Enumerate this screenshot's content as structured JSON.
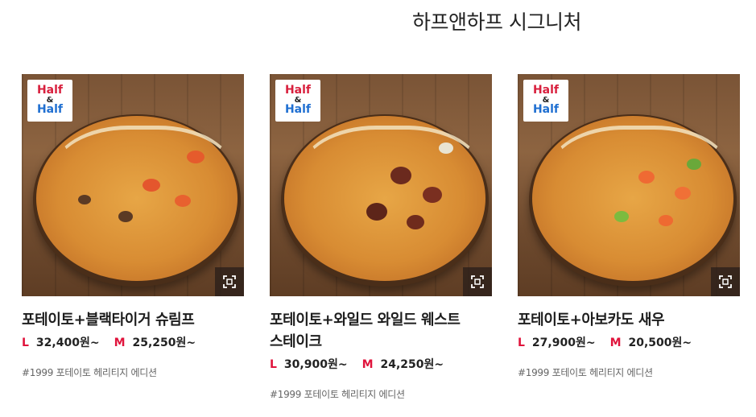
{
  "page": {
    "title": "하프앤하프 시그니처"
  },
  "badge": {
    "line1": "Half",
    "amp": "&",
    "line2": "Half"
  },
  "products": [
    {
      "name": "포테이토+블랙타이거 슈림프",
      "price_l_label": "L",
      "price_l": "32,400원~",
      "price_m_label": "M",
      "price_m": "25,250원~",
      "note": "#1999 포테이토 헤리티지 에디션",
      "image_icon": "pizza-image"
    },
    {
      "name": "포테이토+와일드 와일드 웨스트 스테이크",
      "price_l_label": "L",
      "price_l": "30,900원~",
      "price_m_label": "M",
      "price_m": "24,250원~",
      "note": "#1999 포테이토 헤리티지 에디션",
      "image_icon": "pizza-image"
    },
    {
      "name": "포테이토+아보카도 새우",
      "price_l_label": "L",
      "price_l": "27,900원~",
      "price_m_label": "M",
      "price_m": "20,500원~",
      "note": "#1999 포테이토 헤리티지 에디션",
      "image_icon": "pizza-image"
    }
  ],
  "colors": {
    "accent_red": "#e0143c",
    "badge_blue": "#1f6fd1",
    "badge_red": "#d81f3d"
  },
  "icons": {
    "zoom": "zoom-expand-icon"
  }
}
